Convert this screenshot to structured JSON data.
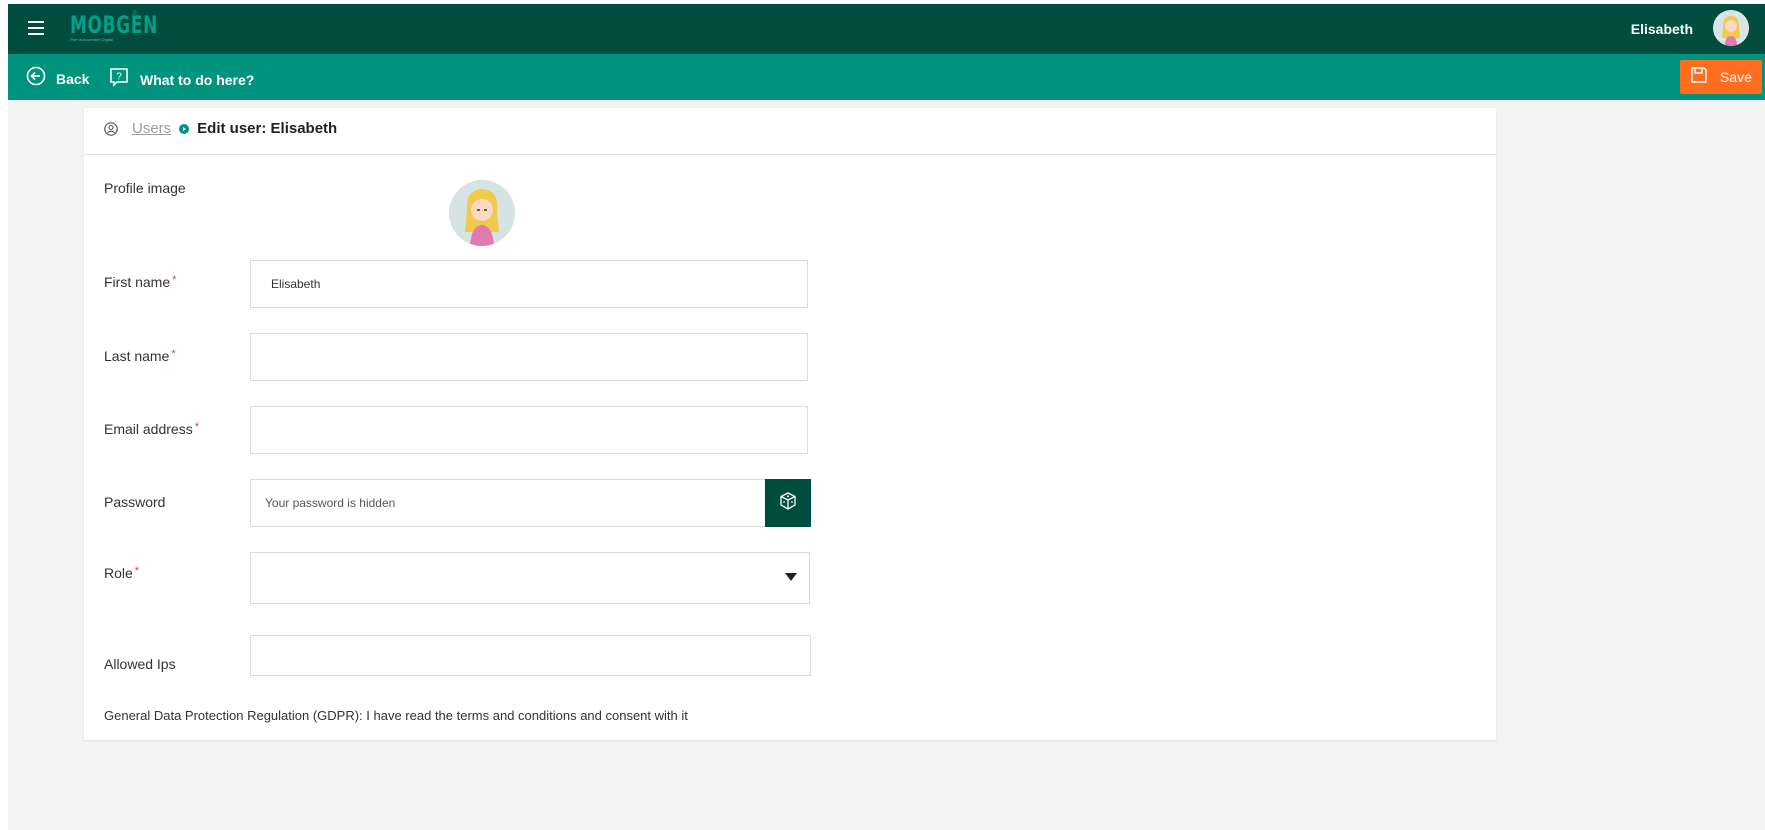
{
  "topbar": {
    "logo_text": "MOBGEN",
    "logo_registered": "®",
    "logo_tagline": "Part of Accenture Digital",
    "user_name": "Elisabeth",
    "menu_icon": "hamburger-menu-icon",
    "avatar_icon": "user-avatar-icon"
  },
  "actionbar": {
    "back_label": "Back",
    "help_label": "What to do here?",
    "save_label": "Save",
    "accent_color": "#00947e",
    "save_color": "#ff6d1f"
  },
  "breadcrumb": {
    "parent": "Users",
    "current": "Edit user: Elisabeth"
  },
  "form": {
    "profile_image_label": "Profile image",
    "first_name_label": "First name",
    "first_name_value": "Elisabeth",
    "last_name_label": "Last name",
    "last_name_value": "",
    "email_label": "Email address",
    "email_value": "",
    "password_label": "Password",
    "password_placeholder": "Your password is hidden",
    "role_label": "Role",
    "role_value": "",
    "allowed_ips_label": "Allowed Ips",
    "allowed_ips_value": "",
    "required_marker": "*",
    "gdpr_text": "General Data Protection Regulation (GDPR): I have read the terms and conditions and consent with it"
  }
}
